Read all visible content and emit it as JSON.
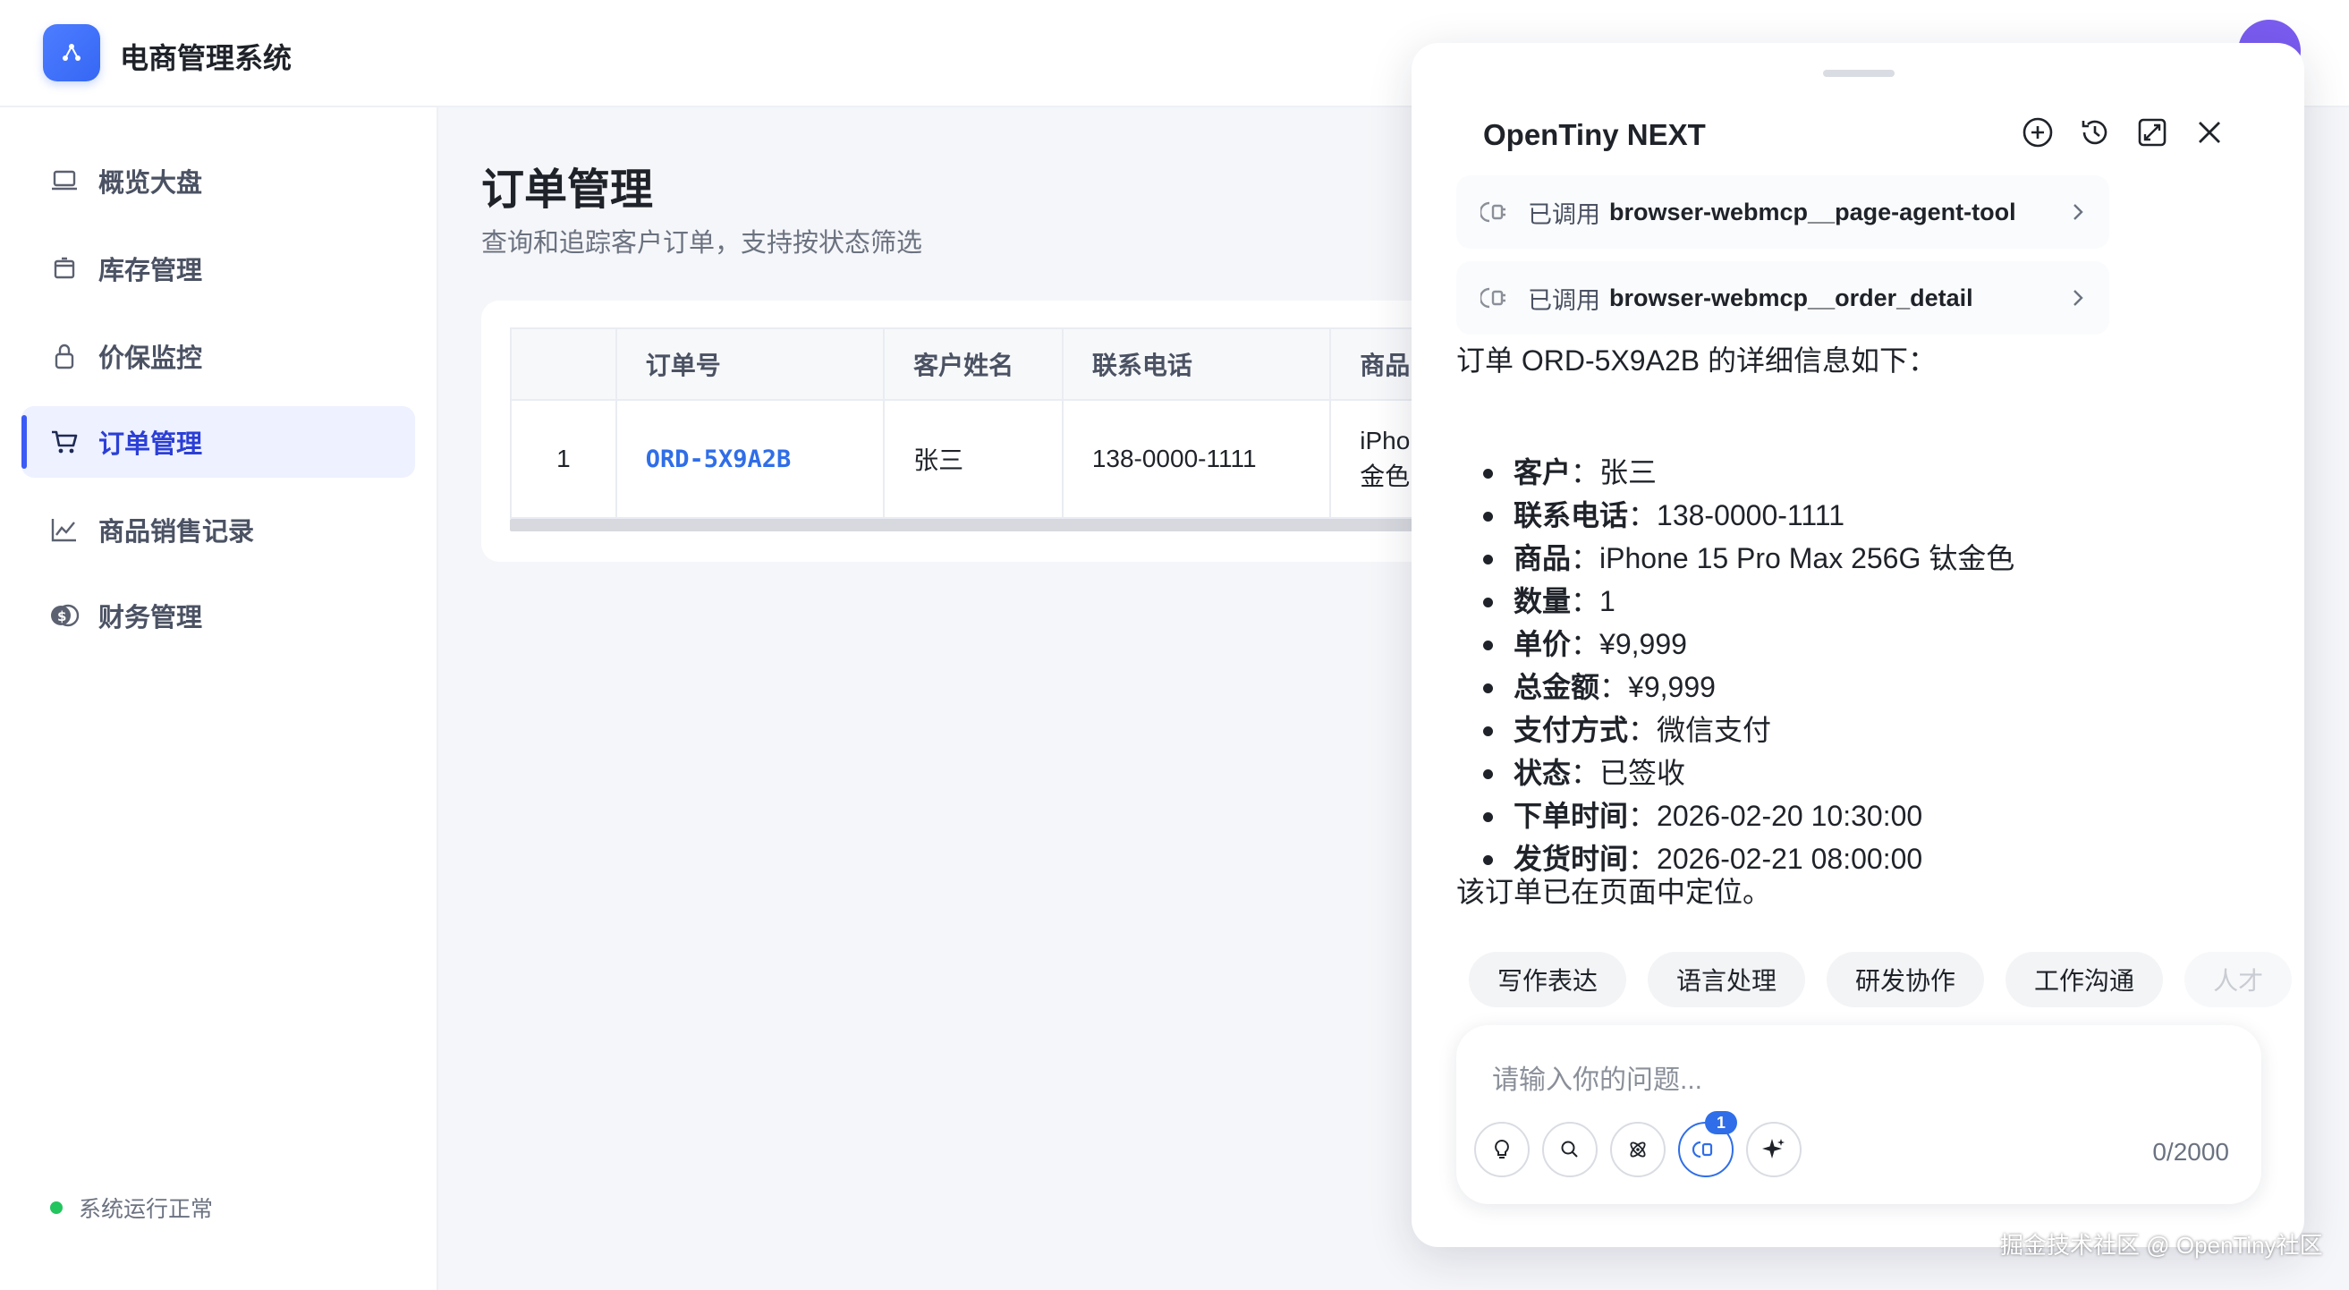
{
  "app": {
    "title": "电商管理系统",
    "top_right_hint": "·· ···",
    "colors": {
      "accent": "#3b5bf5",
      "link": "#2f6ee8",
      "status_ok": "#22c55e"
    }
  },
  "sidebar": {
    "items": [
      {
        "label": "概览大盘",
        "icon": "laptop-icon"
      },
      {
        "label": "库存管理",
        "icon": "box-icon"
      },
      {
        "label": "价保监控",
        "icon": "lock-icon"
      },
      {
        "label": "订单管理",
        "icon": "cart-icon",
        "active": true
      },
      {
        "label": "商品销售记录",
        "icon": "chart-line-icon"
      },
      {
        "label": "财务管理",
        "icon": "coins-icon"
      }
    ],
    "status": "系统运行正常"
  },
  "main": {
    "title": "订单管理",
    "subtitle": "查询和追踪客户订单，支持按状态筛选",
    "table": {
      "headers": [
        "",
        "订单号",
        "客户姓名",
        "联系电话",
        "商品"
      ],
      "rows": [
        {
          "index": "1",
          "order_id": "ORD-5X9A2B",
          "customer": "张三",
          "phone": "138-0000-1111",
          "product_line1": "iPho",
          "product_line2": "金色"
        }
      ]
    }
  },
  "chat": {
    "title": "OpenTiny NEXT",
    "actions": [
      "new-chat-icon",
      "history-icon",
      "expand-icon",
      "close-icon"
    ],
    "tool_calls": [
      {
        "prefix": "已调用",
        "name": "browser-webmcp__page-agent-tool"
      },
      {
        "prefix": "已调用",
        "name": "browser-webmcp__order_detail"
      }
    ],
    "intro": "订单 ORD-5X9A2B 的详细信息如下：",
    "details": [
      {
        "k": "客户",
        "v": "张三"
      },
      {
        "k": "联系电话",
        "v": "138-0000-1111"
      },
      {
        "k": "商品",
        "v": "iPhone 15 Pro Max 256G 钛金色"
      },
      {
        "k": "数量",
        "v": "1"
      },
      {
        "k": "单价",
        "v": "¥9,999"
      },
      {
        "k": "总金额",
        "v": "¥9,999"
      },
      {
        "k": "支付方式",
        "v": "微信支付"
      },
      {
        "k": "状态",
        "v": "已签收"
      },
      {
        "k": "下单时间",
        "v": "2026-02-20 10:30:00"
      },
      {
        "k": "发货时间",
        "v": "2026-02-21 08:00:00"
      }
    ],
    "outro": "该订单已在页面中定位。",
    "chips": [
      "写作表达",
      "语言处理",
      "研发协作",
      "工作沟通",
      "人才"
    ],
    "input_placeholder": "请输入你的问题...",
    "counter": "0/2000",
    "badge": "1"
  },
  "watermark": "掘金技术社区 @ OpenTiny社区"
}
